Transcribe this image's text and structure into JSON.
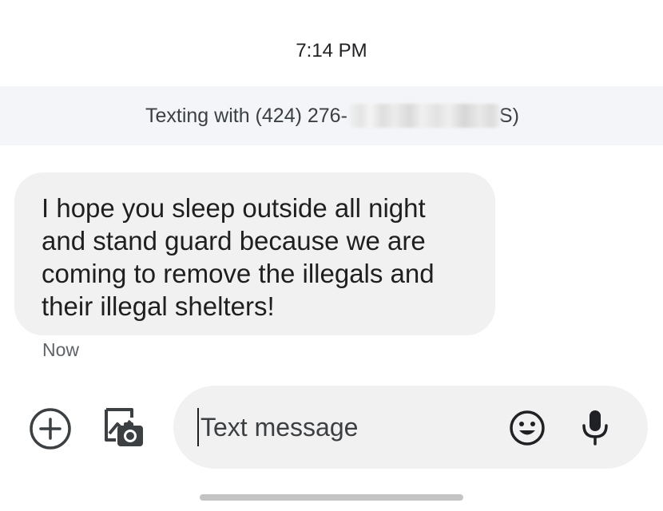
{
  "header": {
    "time": "7:14 PM"
  },
  "banner": {
    "prefix": "Texting with (424) 276-",
    "suffix": "S)"
  },
  "conversation": {
    "messages": [
      {
        "text": "I hope you sleep outside all night\nand stand guard because we are\ncoming to remove the illegals and\ntheir illegal shelters!",
        "timestamp": "Now"
      }
    ]
  },
  "compose": {
    "placeholder": "Text message",
    "icons": {
      "add": "add-circle-icon",
      "gallery": "gallery-camera-icon",
      "emoji": "emoji-icon",
      "mic": "mic-icon"
    }
  },
  "colors": {
    "bubble": "#f1f1f1",
    "banner": "#f3f5f8",
    "text": "#202124"
  }
}
